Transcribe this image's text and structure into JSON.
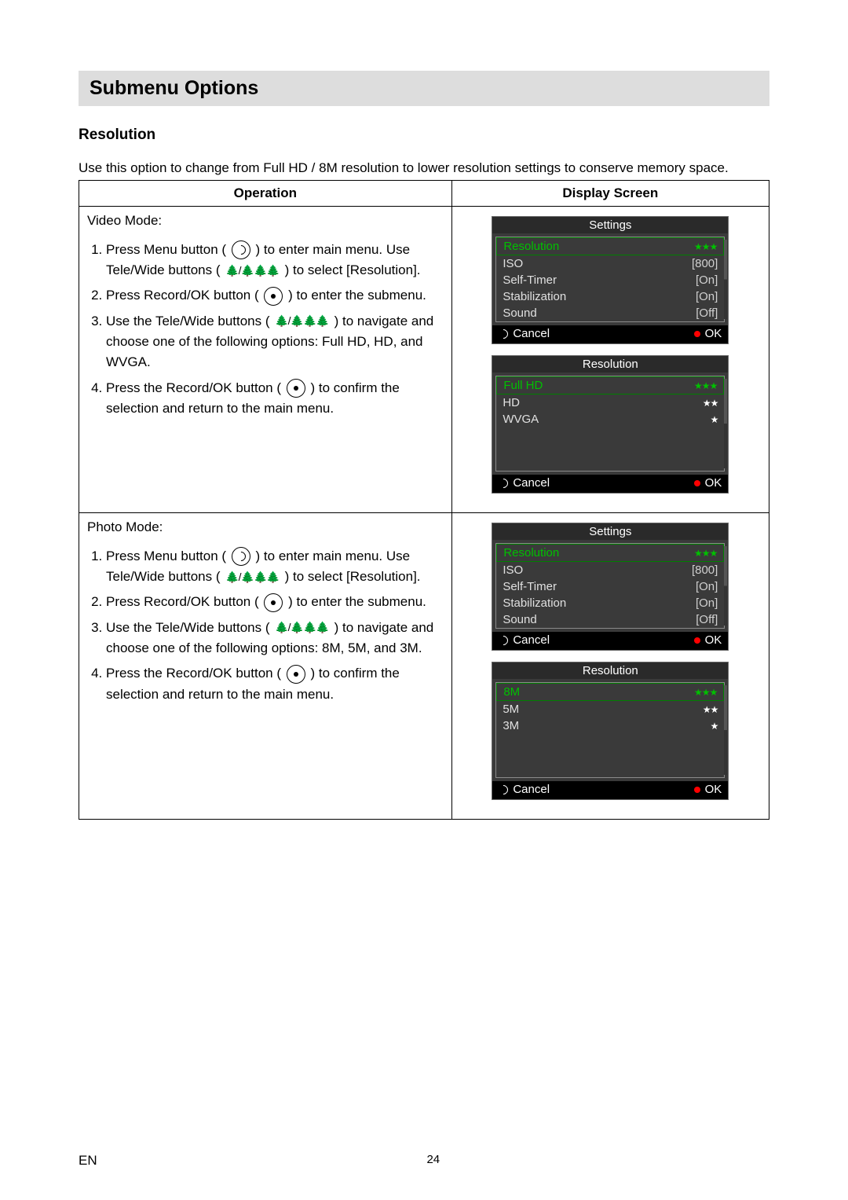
{
  "title": "Submenu Options",
  "subsection": "Resolution",
  "intro": "Use this option to change from Full HD / 8M resolution to lower resolution settings to conserve memory space.",
  "headers": {
    "op": "Operation",
    "disp": "Display Screen"
  },
  "video": {
    "mode": "Video Mode:",
    "s1a": "Press Menu button (",
    "s1b": ") to enter main menu. Use Tele/Wide buttons (",
    "s1c": ") to select [Resolution].",
    "s2a": "Press Record/OK button (",
    "s2b": ") to enter the submenu.",
    "s3a": "Use the Tele/Wide buttons (",
    "s3b": ") to navigate and choose one of the following options: Full HD, HD, and WVGA.",
    "s4a": "Press the Record/OK button (",
    "s4b": ") to confirm the selection and return to the main menu."
  },
  "photo": {
    "mode": "Photo Mode:",
    "s1a": "Press Menu button (",
    "s1b": ") to enter main menu. Use Tele/Wide buttons (",
    "s1c": ") to select [Resolution].",
    "s2a": "Press Record/OK button (",
    "s2b": ") to enter the submenu.",
    "s3a": "Use the Tele/Wide buttons (",
    "s3b": ") to navigate and choose one of the following options: 8M, 5M, and 3M.",
    "s4a": "Press the Record/OK button (",
    "s4b": ") to confirm the selection and return to the main menu."
  },
  "tele_glyph": "🌲/🌲🌲🌲",
  "screens": {
    "settings_title": "Settings",
    "resolution_title": "Resolution",
    "cancel": "Cancel",
    "ok": "OK",
    "settings_rows": [
      {
        "label": "Resolution",
        "value": "",
        "sel": true,
        "stars": "★★★",
        "green": true
      },
      {
        "label": "ISO",
        "value": "[800]"
      },
      {
        "label": "Self-Timer",
        "value": "[On]"
      },
      {
        "label": "Stabilization",
        "value": "[On]"
      },
      {
        "label": "Sound",
        "value": "[Off]"
      }
    ],
    "video_res_rows": [
      {
        "label": "Full HD",
        "value": "",
        "sel": true,
        "stars": "★★★",
        "green": true
      },
      {
        "label": "HD",
        "value": "",
        "stars": "★★"
      },
      {
        "label": "WVGA",
        "value": "",
        "stars": "★"
      }
    ],
    "photo_res_rows": [
      {
        "label": "8M",
        "value": "",
        "sel": true,
        "stars": "★★★",
        "green": true
      },
      {
        "label": "5M",
        "value": "",
        "stars": "★★"
      },
      {
        "label": "3M",
        "value": "",
        "stars": "★"
      }
    ]
  },
  "footer": {
    "lang": "EN",
    "page": "24"
  }
}
